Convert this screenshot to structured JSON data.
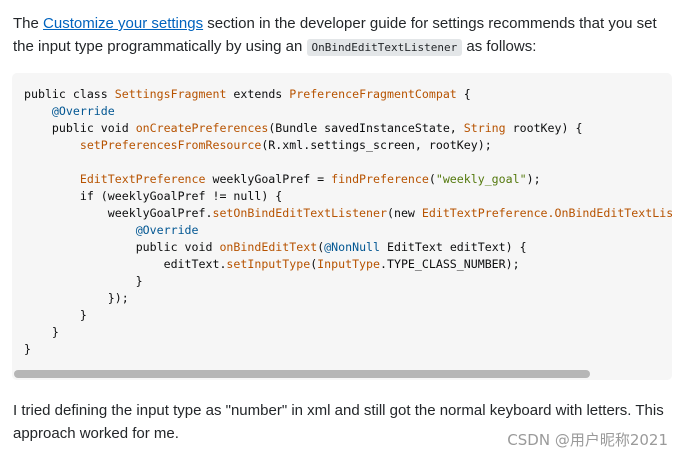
{
  "intro": {
    "before_link": "The ",
    "link_text": "Customize your settings",
    "after_link": " section in the developer guide for settings recommends that you set the input type programmatically by using an ",
    "inline_code": "OnBindEditTextListener",
    "after_code": " as follows:"
  },
  "code_lines": [
    [
      [
        "k",
        "public class "
      ],
      [
        "y",
        "SettingsFragment "
      ],
      [
        "k",
        "extends "
      ],
      [
        "y",
        "PreferenceFragmentCompat"
      ],
      [
        "p",
        " {"
      ]
    ],
    [
      [
        "p",
        "    "
      ],
      [
        "a",
        "@Override"
      ]
    ],
    [
      [
        "p",
        "    "
      ],
      [
        "k",
        "public void "
      ],
      [
        "y",
        "onCreatePreferences"
      ],
      [
        "p",
        "(Bundle savedInstanceState, "
      ],
      [
        "y",
        "String"
      ],
      [
        "p",
        " rootKey) {"
      ]
    ],
    [
      [
        "p",
        "        "
      ],
      [
        "y",
        "setPreferencesFromResource"
      ],
      [
        "p",
        "(R.xml.settings_screen, rootKey);"
      ]
    ],
    [
      [
        "p",
        ""
      ]
    ],
    [
      [
        "p",
        "        "
      ],
      [
        "y",
        "EditTextPreference"
      ],
      [
        "p",
        " weeklyGoalPref = "
      ],
      [
        "y",
        "findPreference"
      ],
      [
        "p",
        "("
      ],
      [
        "s",
        "\"weekly_goal\""
      ],
      [
        "p",
        ");"
      ]
    ],
    [
      [
        "p",
        "        "
      ],
      [
        "k",
        "if"
      ],
      [
        "p",
        " (weeklyGoalPref != "
      ],
      [
        "k",
        "null"
      ],
      [
        "p",
        ") {"
      ]
    ],
    [
      [
        "p",
        "            weeklyGoalPref."
      ],
      [
        "y",
        "setOnBindEditTextListener"
      ],
      [
        "p",
        "("
      ],
      [
        "k",
        "new "
      ],
      [
        "y",
        "EditTextPreference.OnBindEditTextListener"
      ],
      [
        "p",
        "() {"
      ]
    ],
    [
      [
        "p",
        "                "
      ],
      [
        "a",
        "@Override"
      ]
    ],
    [
      [
        "p",
        "                "
      ],
      [
        "k",
        "public void "
      ],
      [
        "y",
        "onBindEditText"
      ],
      [
        "p",
        "("
      ],
      [
        "a",
        "@NonNull"
      ],
      [
        "p",
        " EditText editText) {"
      ]
    ],
    [
      [
        "p",
        "                    editText."
      ],
      [
        "y",
        "setInputType"
      ],
      [
        "p",
        "("
      ],
      [
        "y",
        "InputType"
      ],
      [
        "p",
        ".TYPE_CLASS_NUMBER);"
      ]
    ],
    [
      [
        "p",
        "                }"
      ]
    ],
    [
      [
        "p",
        "            });"
      ]
    ],
    [
      [
        "p",
        "        }"
      ]
    ],
    [
      [
        "p",
        "    }"
      ]
    ],
    [
      [
        "p",
        "}"
      ]
    ]
  ],
  "outro": {
    "text": "I tried defining the input type as \"number\" in xml and still got the normal keyboard with letters. This approach worked for me."
  },
  "watermark": "CSDN @用户昵称2021",
  "colors": {
    "link": "#0063be",
    "code_background": "#f6f6f6",
    "keyword": "#0c0d0e",
    "type": "#b75301",
    "annotation": "#015692",
    "string": "#54790d"
  }
}
